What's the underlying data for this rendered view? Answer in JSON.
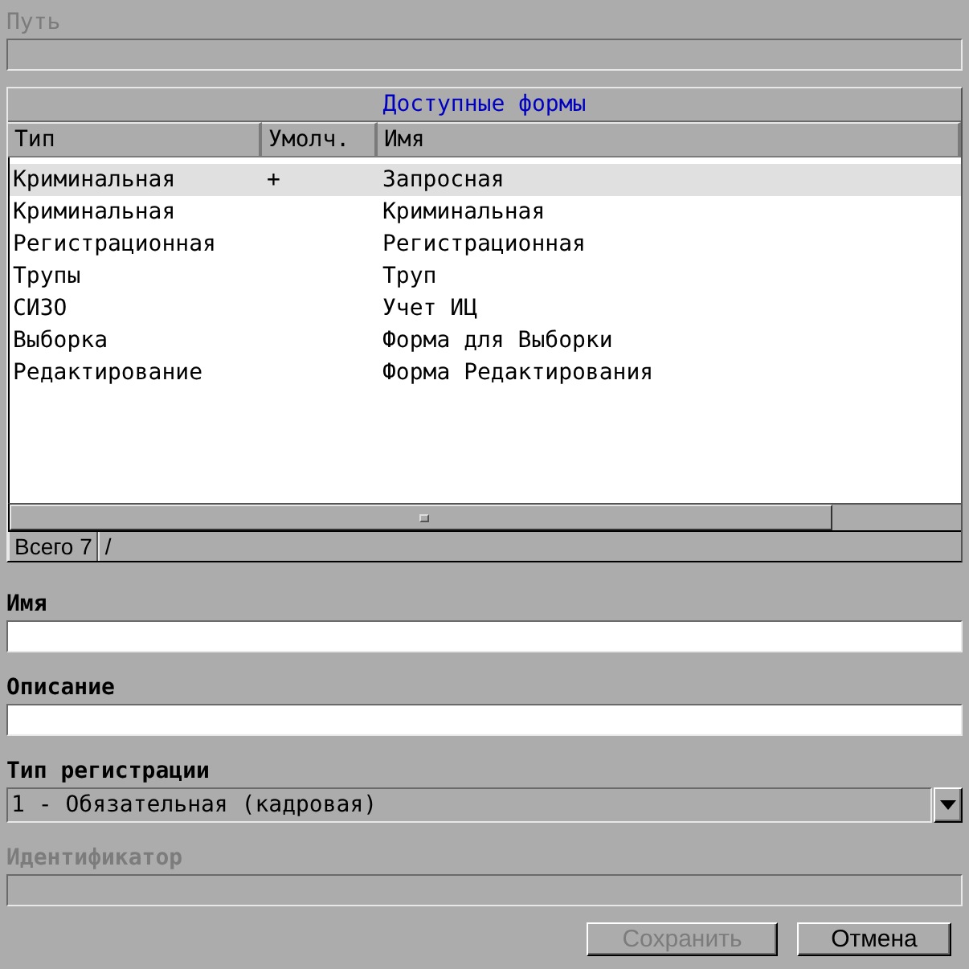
{
  "path": {
    "label": "Путь",
    "disabled": true
  },
  "forms_table": {
    "title": "Доступные формы",
    "columns": [
      "Тип",
      "Умолч.",
      "Имя"
    ],
    "rows": [
      {
        "cells": [
          "Криминальная",
          "+",
          "Запросная"
        ],
        "selected": true
      },
      {
        "cells": [
          "Криминальная",
          "",
          "Криминальная"
        ],
        "selected": false
      },
      {
        "cells": [
          "Регистрационная",
          "",
          "Регистрационная"
        ],
        "selected": false
      },
      {
        "cells": [
          "Трупы",
          "",
          "Труп"
        ],
        "selected": false
      },
      {
        "cells": [
          "СИЗО",
          "",
          "Учет ИЦ"
        ],
        "selected": false
      },
      {
        "cells": [
          "Выборка",
          "",
          "Форма для Выборки"
        ],
        "selected": false
      },
      {
        "cells": [
          "Редактирование",
          "",
          "Форма Редактирования"
        ],
        "selected": false
      }
    ],
    "status": [
      "Всего 7",
      "/"
    ]
  },
  "fields": [
    {
      "kind": "text",
      "label": "Имя",
      "disabled": false
    },
    {
      "kind": "text",
      "label": "Описание",
      "disabled": false
    },
    {
      "kind": "select",
      "label": "Тип регистрации",
      "value": "1 - Обязательная (кадровая)",
      "disabled": false
    },
    {
      "kind": "text",
      "label": "Идентификатор",
      "disabled": true
    }
  ],
  "buttons": [
    {
      "label": "Сохранить",
      "disabled": true
    },
    {
      "label": "Отмена",
      "disabled": false
    }
  ]
}
